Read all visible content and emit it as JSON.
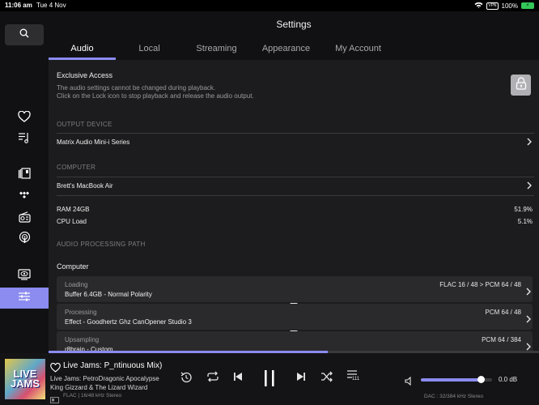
{
  "status_bar": {
    "time": "11:06 am",
    "date": "Tue 4 Nov",
    "vpn": "VPN",
    "battery_percent": "100%",
    "battery_icon_text": "⚡"
  },
  "sidebar": {
    "items": [
      "search-icon",
      "heart-icon",
      "playlist-icon",
      "library-icon",
      "tidal-icon",
      "radio-icon",
      "podcast-icon",
      "display-icon",
      "settings-sliders-icon"
    ],
    "active": "settings-sliders-icon"
  },
  "header": {
    "title": "Settings",
    "tabs": [
      {
        "label": "Audio"
      },
      {
        "label": "Local"
      },
      {
        "label": "Streaming"
      },
      {
        "label": "Appearance"
      },
      {
        "label": "My Account"
      }
    ],
    "active_tab": "Audio"
  },
  "main": {
    "exclusive": {
      "title": "Exclusive Access",
      "desc_line1": "The audio settings cannot be changed during playback.",
      "desc_line2": "Click on the Lock icon to stop playback and release the audio output."
    },
    "output_device": {
      "section": "OUTPUT DEVICE",
      "value": "Matrix Audio Mini-i Series"
    },
    "computer": {
      "section": "COMPUTER",
      "value": "Brett's MacBook Air",
      "ram_label": "RAM 24GB",
      "ram_value": "51.9%",
      "cpu_label": "CPU Load",
      "cpu_value": "5.1%"
    },
    "path": {
      "section": "AUDIO PROCESSING PATH",
      "subtitle": "Computer",
      "cards": [
        {
          "label": "Loading",
          "value": "Buffer 6.4GB - Normal Polarity",
          "format": "FLAC 16 / 48 > PCM 64 / 48"
        },
        {
          "label": "Processing",
          "value": "Effect - Goodhertz Ghz CanOpener Studio 3",
          "format": "PCM 64 / 48"
        },
        {
          "label": "Upsampling",
          "value": "r8brain - Custom",
          "format": "PCM 64 / 384"
        }
      ]
    }
  },
  "playback": {
    "progress": 0.57
  },
  "player": {
    "art_text": "LIVE JAMS",
    "title": "Live Jams: P_ntinuous Mix)",
    "line1": "Live Jams: PetroDragonic Apocalypse",
    "line2": "King Gizzard & The Lizard Wizard",
    "format": "FLAC | 16/48 kHz Stereo",
    "queue_count": "111",
    "volume": 0.84,
    "volume_label": "0.0 dB",
    "dac": "DAC : 32/384 kHz Stereo"
  },
  "colors": {
    "accent": "#8b8bf0",
    "background": "#1c1c1e",
    "sidebar": "#111113"
  }
}
